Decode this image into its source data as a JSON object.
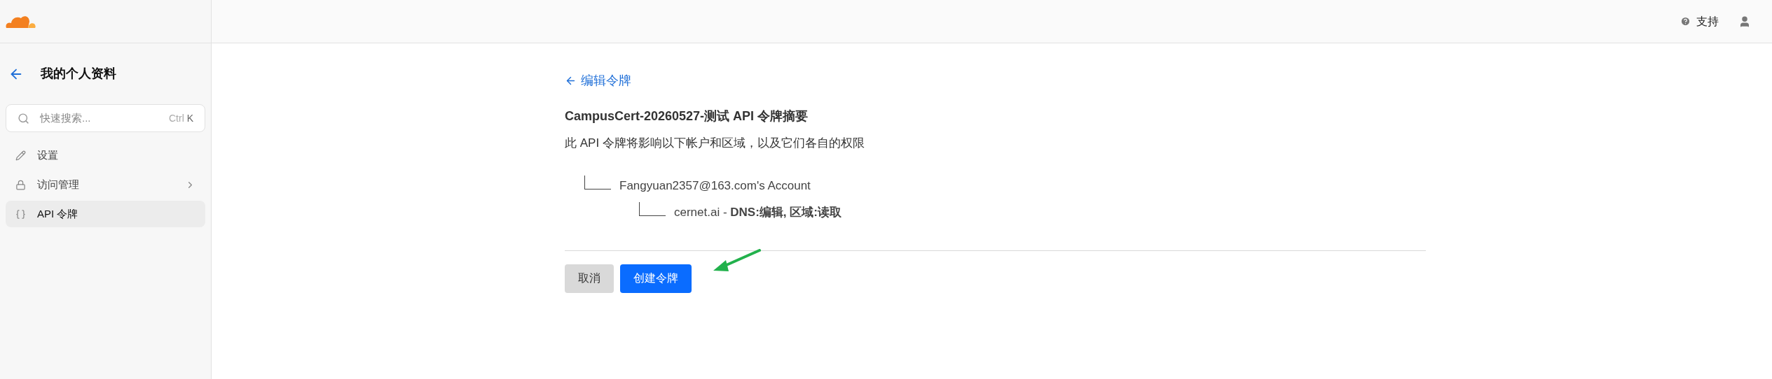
{
  "sidebar": {
    "title": "我的个人资料",
    "search": {
      "placeholder": "快速搜索...",
      "shortcut_modifier": "Ctrl",
      "shortcut_key": "K"
    },
    "items": [
      {
        "label": "设置",
        "selected": false,
        "has_submenu": false
      },
      {
        "label": "访问管理",
        "selected": false,
        "has_submenu": true
      },
      {
        "label": "API 令牌",
        "selected": true,
        "has_submenu": false
      }
    ]
  },
  "top_bar": {
    "support": "支持"
  },
  "main": {
    "back_link": "编辑令牌",
    "title": "CampusCert-20260527-测试 API 令牌摘要",
    "description": "此 API 令牌将影响以下帐户和区域，以及它们各自的权限",
    "tree": [
      {
        "label": "Fangyuan2357@163.com's Account",
        "children": [
          {
            "label": "cernet.ai - **DNS:编辑, 区域:读取**"
          }
        ]
      }
    ],
    "buttons": [
      {
        "label": "取消",
        "kind": "secondary"
      },
      {
        "label": "创建令牌",
        "kind": "primary"
      }
    ]
  }
}
